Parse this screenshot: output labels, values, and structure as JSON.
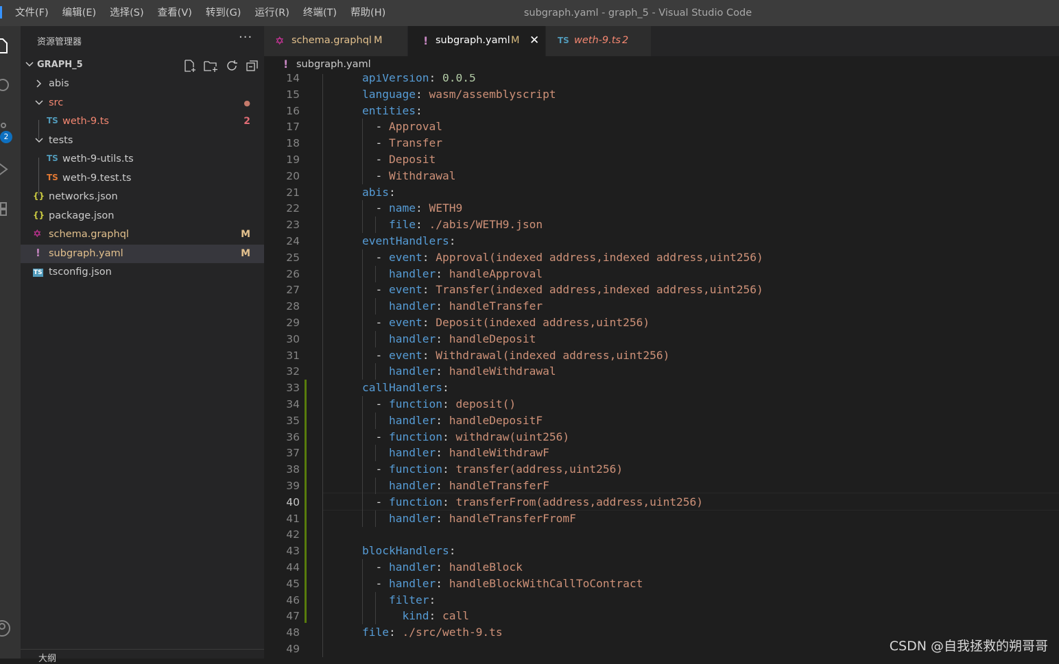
{
  "window": {
    "title": "subgraph.yaml - graph_5 - Visual Studio Code",
    "menu": [
      "文件(F)",
      "编辑(E)",
      "选择(S)",
      "查看(V)",
      "转到(G)",
      "运行(R)",
      "终端(T)",
      "帮助(H)"
    ]
  },
  "activity": {
    "scm_badge": "2"
  },
  "sidebar": {
    "title": "资源管理器",
    "more": "···",
    "section": "GRAPH_5",
    "tree": [
      {
        "label": "abis",
        "type": "folder",
        "expanded": false,
        "depth": 0,
        "icon_text": "",
        "badge": ""
      },
      {
        "label": "src",
        "type": "folder",
        "expanded": true,
        "depth": 0,
        "icon_text": "",
        "badge": "●"
      },
      {
        "label": "weth-9.ts",
        "type": "file",
        "depth": 1,
        "icon_text": "TS",
        "badge": "2"
      },
      {
        "label": "tests",
        "type": "folder",
        "expanded": true,
        "depth": 0,
        "icon_text": "",
        "badge": ""
      },
      {
        "label": "weth-9-utils.ts",
        "type": "file",
        "depth": 1,
        "icon_text": "TS",
        "badge": ""
      },
      {
        "label": "weth-9.test.ts",
        "type": "file",
        "depth": 1,
        "icon_text": "TS",
        "badge": ""
      },
      {
        "label": "networks.json",
        "type": "file",
        "depth": 0,
        "icon_text": "{}",
        "badge": ""
      },
      {
        "label": "package.json",
        "type": "file",
        "depth": 0,
        "icon_text": "{}",
        "badge": ""
      },
      {
        "label": "schema.graphql",
        "type": "file",
        "depth": 0,
        "icon_text": "✡",
        "badge": "M"
      },
      {
        "label": "subgraph.yaml",
        "type": "file",
        "depth": 0,
        "icon_text": "!",
        "badge": "M"
      },
      {
        "label": "tsconfig.json",
        "type": "file",
        "depth": 0,
        "icon_text": "TS",
        "badge": ""
      }
    ],
    "outline": "大纲"
  },
  "tabs": [
    {
      "label": "schema.graphql",
      "icon_text": "✡",
      "status": "M",
      "active": false
    },
    {
      "label": "subgraph.yaml",
      "icon_text": "!",
      "status": "M",
      "active": true,
      "close": "✕"
    },
    {
      "label": "weth-9.ts",
      "icon_text": "TS",
      "status": "2",
      "active": false
    }
  ],
  "breadcrumb": {
    "icon_text": "!",
    "label": "subgraph.yaml"
  },
  "editor": {
    "current_line": 40,
    "lines": [
      {
        "n": 14,
        "t": [
          [
            "k",
            "apiVersion"
          ],
          [
            "p",
            ": "
          ],
          [
            "n",
            "0.0.5"
          ]
        ]
      },
      {
        "n": 15,
        "t": [
          [
            "k",
            "language"
          ],
          [
            "p",
            ": "
          ],
          [
            "s",
            "wasm/assemblyscript"
          ]
        ]
      },
      {
        "n": 16,
        "t": [
          [
            "k",
            "entities"
          ],
          [
            "p",
            ":"
          ]
        ]
      },
      {
        "n": 17,
        "t": [
          [
            "p",
            "  - "
          ],
          [
            "s",
            "Approval"
          ]
        ]
      },
      {
        "n": 18,
        "t": [
          [
            "p",
            "  - "
          ],
          [
            "s",
            "Transfer"
          ]
        ]
      },
      {
        "n": 19,
        "t": [
          [
            "p",
            "  - "
          ],
          [
            "s",
            "Deposit"
          ]
        ]
      },
      {
        "n": 20,
        "t": [
          [
            "p",
            "  - "
          ],
          [
            "s",
            "Withdrawal"
          ]
        ]
      },
      {
        "n": 21,
        "t": [
          [
            "k",
            "abis"
          ],
          [
            "p",
            ":"
          ]
        ]
      },
      {
        "n": 22,
        "t": [
          [
            "p",
            "  - "
          ],
          [
            "k",
            "name"
          ],
          [
            "p",
            ": "
          ],
          [
            "s",
            "WETH9"
          ]
        ]
      },
      {
        "n": 23,
        "t": [
          [
            "p",
            "    "
          ],
          [
            "k",
            "file"
          ],
          [
            "p",
            ": "
          ],
          [
            "s",
            "./abis/WETH9.json"
          ]
        ]
      },
      {
        "n": 24,
        "t": [
          [
            "k",
            "eventHandlers"
          ],
          [
            "p",
            ":"
          ]
        ]
      },
      {
        "n": 25,
        "t": [
          [
            "p",
            "  - "
          ],
          [
            "k",
            "event"
          ],
          [
            "p",
            ": "
          ],
          [
            "s",
            "Approval(indexed address,indexed address,uint256)"
          ]
        ]
      },
      {
        "n": 26,
        "t": [
          [
            "p",
            "    "
          ],
          [
            "k",
            "handler"
          ],
          [
            "p",
            ": "
          ],
          [
            "s",
            "handleApproval"
          ]
        ]
      },
      {
        "n": 27,
        "t": [
          [
            "p",
            "  - "
          ],
          [
            "k",
            "event"
          ],
          [
            "p",
            ": "
          ],
          [
            "s",
            "Transfer(indexed address,indexed address,uint256)"
          ]
        ]
      },
      {
        "n": 28,
        "t": [
          [
            "p",
            "    "
          ],
          [
            "k",
            "handler"
          ],
          [
            "p",
            ": "
          ],
          [
            "s",
            "handleTransfer"
          ]
        ]
      },
      {
        "n": 29,
        "t": [
          [
            "p",
            "  - "
          ],
          [
            "k",
            "event"
          ],
          [
            "p",
            ": "
          ],
          [
            "s",
            "Deposit(indexed address,uint256)"
          ]
        ]
      },
      {
        "n": 30,
        "t": [
          [
            "p",
            "    "
          ],
          [
            "k",
            "handler"
          ],
          [
            "p",
            ": "
          ],
          [
            "s",
            "handleDeposit"
          ]
        ]
      },
      {
        "n": 31,
        "t": [
          [
            "p",
            "  - "
          ],
          [
            "k",
            "event"
          ],
          [
            "p",
            ": "
          ],
          [
            "s",
            "Withdrawal(indexed address,uint256)"
          ]
        ]
      },
      {
        "n": 32,
        "t": [
          [
            "p",
            "    "
          ],
          [
            "k",
            "handler"
          ],
          [
            "p",
            ": "
          ],
          [
            "s",
            "handleWithdrawal"
          ]
        ]
      },
      {
        "n": 33,
        "t": [
          [
            "k",
            "callHandlers"
          ],
          [
            "p",
            ":"
          ]
        ]
      },
      {
        "n": 34,
        "t": [
          [
            "p",
            "  - "
          ],
          [
            "k",
            "function"
          ],
          [
            "p",
            ": "
          ],
          [
            "s",
            "deposit()"
          ]
        ]
      },
      {
        "n": 35,
        "t": [
          [
            "p",
            "    "
          ],
          [
            "k",
            "handler"
          ],
          [
            "p",
            ": "
          ],
          [
            "s",
            "handleDepositF"
          ]
        ]
      },
      {
        "n": 36,
        "t": [
          [
            "p",
            "  - "
          ],
          [
            "k",
            "function"
          ],
          [
            "p",
            ": "
          ],
          [
            "s",
            "withdraw(uint256)"
          ]
        ]
      },
      {
        "n": 37,
        "t": [
          [
            "p",
            "    "
          ],
          [
            "k",
            "handler"
          ],
          [
            "p",
            ": "
          ],
          [
            "s",
            "handleWithdrawF"
          ]
        ]
      },
      {
        "n": 38,
        "t": [
          [
            "p",
            "  - "
          ],
          [
            "k",
            "function"
          ],
          [
            "p",
            ": "
          ],
          [
            "s",
            "transfer(address,uint256)"
          ]
        ]
      },
      {
        "n": 39,
        "t": [
          [
            "p",
            "    "
          ],
          [
            "k",
            "handler"
          ],
          [
            "p",
            ": "
          ],
          [
            "s",
            "handleTransferF"
          ]
        ]
      },
      {
        "n": 40,
        "t": [
          [
            "p",
            "  - "
          ],
          [
            "k",
            "function"
          ],
          [
            "p",
            ": "
          ],
          [
            "s",
            "transferFrom(address,address,uint256)"
          ]
        ]
      },
      {
        "n": 41,
        "t": [
          [
            "p",
            "    "
          ],
          [
            "k",
            "handler"
          ],
          [
            "p",
            ": "
          ],
          [
            "s",
            "handleTransferFromF"
          ]
        ]
      },
      {
        "n": 42,
        "t": []
      },
      {
        "n": 43,
        "t": [
          [
            "k",
            "blockHandlers"
          ],
          [
            "p",
            ":"
          ]
        ]
      },
      {
        "n": 44,
        "t": [
          [
            "p",
            "  - "
          ],
          [
            "k",
            "handler"
          ],
          [
            "p",
            ": "
          ],
          [
            "s",
            "handleBlock"
          ]
        ]
      },
      {
        "n": 45,
        "t": [
          [
            "p",
            "  - "
          ],
          [
            "k",
            "handler"
          ],
          [
            "p",
            ": "
          ],
          [
            "s",
            "handleBlockWithCallToContract"
          ]
        ]
      },
      {
        "n": 46,
        "t": [
          [
            "p",
            "    "
          ],
          [
            "k",
            "filter"
          ],
          [
            "p",
            ":"
          ]
        ]
      },
      {
        "n": 47,
        "t": [
          [
            "p",
            "      "
          ],
          [
            "k",
            "kind"
          ],
          [
            "p",
            ": "
          ],
          [
            "s",
            "call"
          ]
        ]
      },
      {
        "n": 48,
        "t": [
          [
            "k",
            "file"
          ],
          [
            "p",
            ": "
          ],
          [
            "s",
            "./src/weth-9.ts"
          ]
        ]
      },
      {
        "n": 49,
        "t": []
      }
    ]
  },
  "watermark": "CSDN @自我拯救的朔哥哥",
  "colors": {
    "accent": "#0e70c0",
    "modified_file": "#e2c08d",
    "error_file": "#f48771",
    "ts_icon": "#519aba",
    "yaml_icon": "#c586c0",
    "graphql_icon": "#e535ab",
    "json_icon": "#cbcb41"
  }
}
